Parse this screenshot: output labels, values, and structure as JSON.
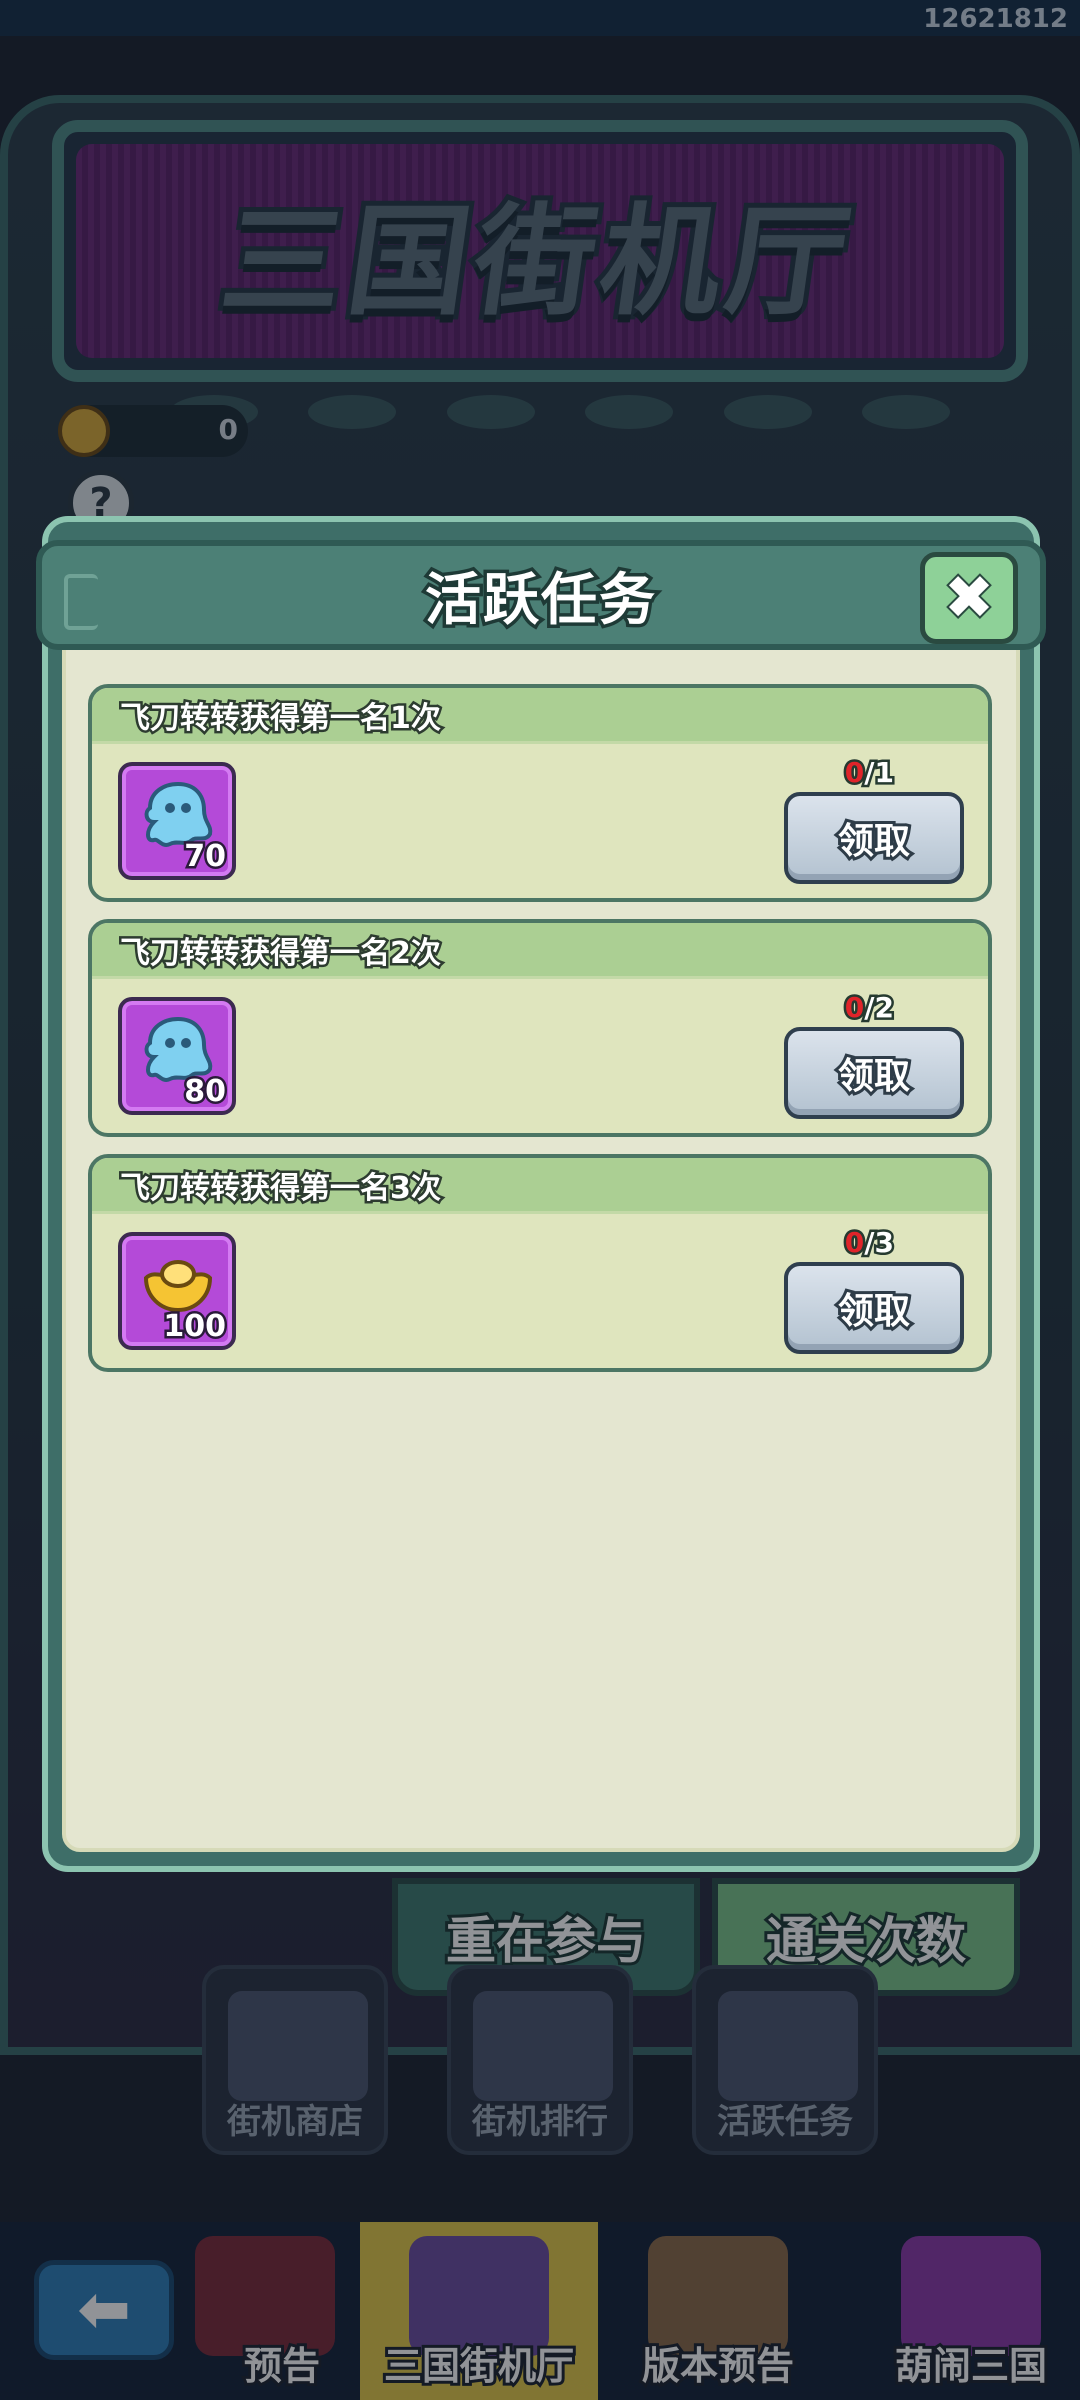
{
  "header": {
    "user_id": "12621812"
  },
  "background": {
    "marquee_title": "三国街机厅",
    "coin_count": "0",
    "help_label": "?"
  },
  "modal": {
    "title": "活跃任务",
    "close_glyph": "✖",
    "tasks": [
      {
        "name": "飞刀转转获得第一名1次",
        "reward": {
          "icon": "spirit-icon",
          "quantity": "70"
        },
        "progress_done": "0",
        "progress_total": "/1",
        "claim_label": "领取"
      },
      {
        "name": "飞刀转转获得第一名2次",
        "reward": {
          "icon": "spirit-icon",
          "quantity": "80"
        },
        "progress_done": "0",
        "progress_total": "/2",
        "claim_label": "领取"
      },
      {
        "name": "飞刀转转获得第一名3次",
        "reward": {
          "icon": "gold-ingot-icon",
          "quantity": "100"
        },
        "progress_done": "0",
        "progress_total": "/3",
        "claim_label": "领取"
      }
    ]
  },
  "actions": {
    "rejoin": "重在参与",
    "clear_count": "通关次数"
  },
  "shortcuts": [
    {
      "label": "街机商店",
      "icon": "treasure-chest-icon"
    },
    {
      "label": "街机排行",
      "icon": "podium-icon"
    },
    {
      "label": "活跃任务",
      "icon": "clipboard-icon"
    }
  ],
  "bottom_nav": {
    "back_glyph": "⬅",
    "items": [
      {
        "label": "预告",
        "icon": "preview-icon"
      },
      {
        "label": "三国街机厅",
        "icon": "arcade-cabinet-icon",
        "active": true
      },
      {
        "label": "版本预告",
        "icon": "house-icon"
      },
      {
        "label": "葫闹三国",
        "icon": "gourd-icon"
      }
    ]
  },
  "colors": {
    "accent": "#4c8076",
    "active_tab": "#e2c94a",
    "reward_bg": "#b44ad8",
    "progress_zero": "#e0242a"
  }
}
